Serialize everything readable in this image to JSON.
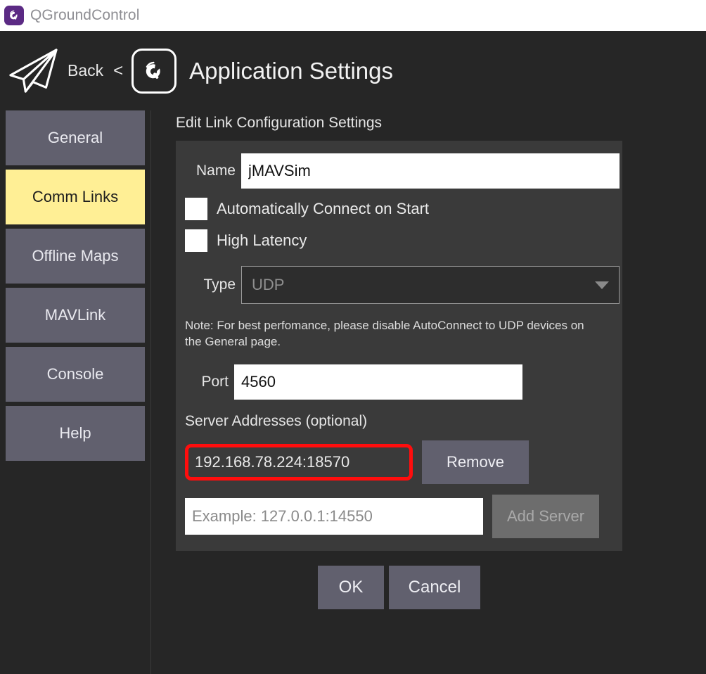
{
  "titlebar": {
    "app_name": "QGroundControl",
    "icon": "qgc-app-icon"
  },
  "header": {
    "plane_icon": "paper-plane-icon",
    "back_label": "Back",
    "back_chevron": "<",
    "badge_icon": "qgc-logo-icon",
    "title": "Application Settings"
  },
  "sidebar": {
    "items": [
      {
        "label": "General",
        "selected": false
      },
      {
        "label": "Comm Links",
        "selected": true
      },
      {
        "label": "Offline Maps",
        "selected": false
      },
      {
        "label": "MAVLink",
        "selected": false
      },
      {
        "label": "Console",
        "selected": false
      },
      {
        "label": "Help",
        "selected": false
      }
    ]
  },
  "main": {
    "section_title": "Edit Link Configuration Settings",
    "name": {
      "label": "Name",
      "value": "jMAVSim"
    },
    "checkboxes": [
      {
        "label": "Automatically Connect on Start",
        "checked": false
      },
      {
        "label": "High Latency",
        "checked": false
      }
    ],
    "type": {
      "label": "Type",
      "value": "UDP",
      "caret_icon": "chevron-down-icon"
    },
    "note": "Note: For best perfomance, please disable AutoConnect to UDP devices on the General page.",
    "port": {
      "label": "Port",
      "value": "4560"
    },
    "servers": {
      "title": "Server Addresses (optional)",
      "entries": [
        {
          "address": "192.168.78.224:18570",
          "remove_label": "Remove",
          "highlight_color": "#ff0d0d"
        }
      ],
      "new_entry": {
        "placeholder": "Example: 127.0.0.1:14550",
        "value": "",
        "add_label": "Add Server"
      }
    }
  },
  "footer": {
    "ok_label": "OK",
    "cancel_label": "Cancel"
  },
  "colors": {
    "page_background": "#262626",
    "panel_background": "#3a3a3a",
    "nav_button": "#61606e",
    "nav_selected": "#ffef95",
    "accent_highlight": "#ff0d0d",
    "titlebar_background": "#ffffff",
    "app_icon_purple": "#5b2a84"
  }
}
